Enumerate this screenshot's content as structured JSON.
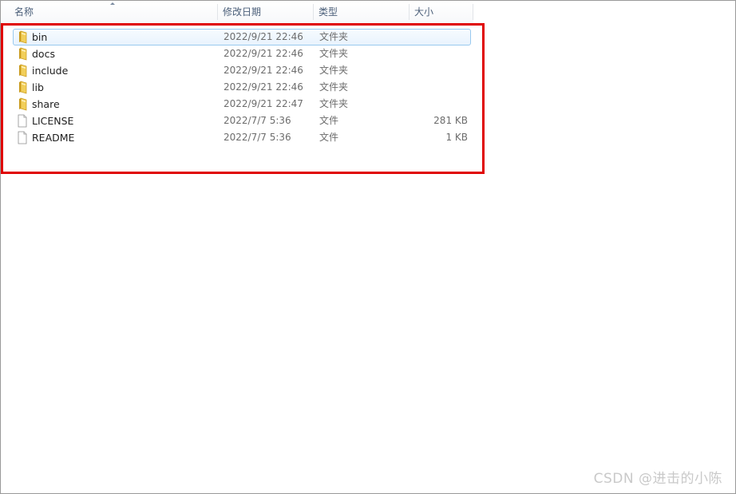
{
  "columns": {
    "name": "名称",
    "date": "修改日期",
    "type": "类型",
    "size": "大小"
  },
  "files": [
    {
      "name": "bin",
      "date": "2022/9/21 22:46",
      "type": "文件夹",
      "size": "",
      "icon": "folder-icon",
      "selected": true
    },
    {
      "name": "docs",
      "date": "2022/9/21 22:46",
      "type": "文件夹",
      "size": "",
      "icon": "folder-icon",
      "selected": false
    },
    {
      "name": "include",
      "date": "2022/9/21 22:46",
      "type": "文件夹",
      "size": "",
      "icon": "folder-icon",
      "selected": false
    },
    {
      "name": "lib",
      "date": "2022/9/21 22:46",
      "type": "文件夹",
      "size": "",
      "icon": "folder-icon",
      "selected": false
    },
    {
      "name": "share",
      "date": "2022/9/21 22:47",
      "type": "文件夹",
      "size": "",
      "icon": "folder-icon",
      "selected": false
    },
    {
      "name": "LICENSE",
      "date": "2022/7/7 5:36",
      "type": "文件",
      "size": "281 KB",
      "icon": "file-icon",
      "selected": false
    },
    {
      "name": "README",
      "date": "2022/7/7 5:36",
      "type": "文件",
      "size": "1 KB",
      "icon": "file-icon",
      "selected": false
    }
  ],
  "watermark": "CSDN @进击的小陈",
  "colors": {
    "annotation_border": "#e00000",
    "selection_border": "#99c9ef",
    "header_text": "#4c607a"
  }
}
